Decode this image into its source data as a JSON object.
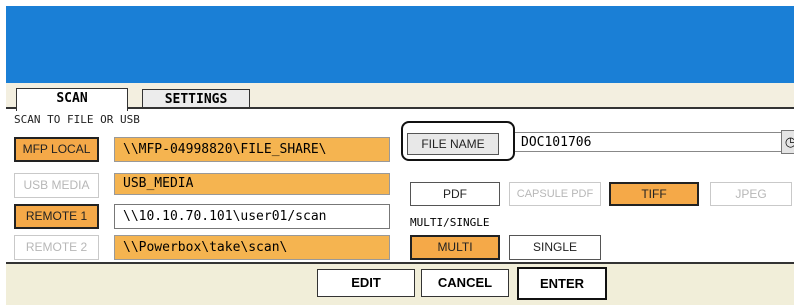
{
  "tabs": {
    "scan": "SCAN",
    "settings": "SETTINGS"
  },
  "section_label": "SCAN TO FILE OR USB",
  "destinations": [
    {
      "button": "MFP LOCAL",
      "path": "\\\\MFP-04998820\\FILE_SHARE\\"
    },
    {
      "button": "USB MEDIA",
      "path": "USB_MEDIA"
    },
    {
      "button": "REMOTE 1",
      "path": "\\\\10.10.70.101\\user01/scan"
    },
    {
      "button": "REMOTE 2",
      "path": "\\\\Powerbox\\take\\scan\\"
    }
  ],
  "file_name": {
    "button": "FILE NAME",
    "value": "DOC101706"
  },
  "formats": [
    "PDF",
    "CAPSULE PDF",
    "TIFF",
    "JPEG"
  ],
  "selected_format": "TIFF",
  "multi_single": {
    "label": "MULTI/SINGLE",
    "multi": "MULTI",
    "single": "SINGLE",
    "selected": "MULTI"
  },
  "actions": {
    "edit": "EDIT",
    "cancel": "CANCEL",
    "enter": "ENTER"
  },
  "icons": {
    "clock": "clock-icon"
  },
  "colors": {
    "header": "#1a7fd6",
    "selected": "#f5a948",
    "path_highlight": "#f5b450"
  }
}
